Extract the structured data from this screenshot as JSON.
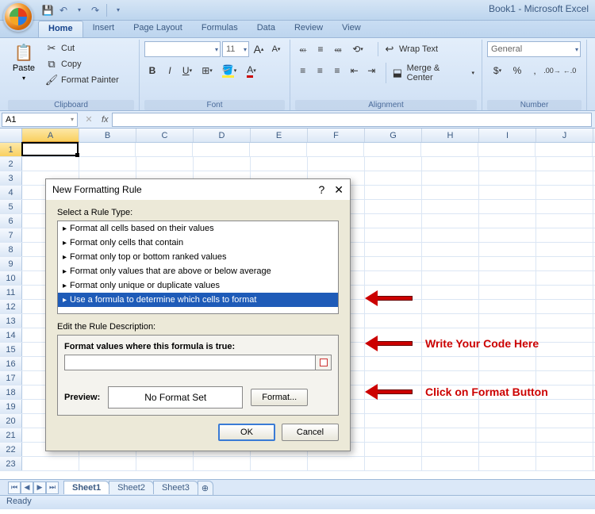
{
  "app": {
    "title": "Book1 - Microsoft Excel"
  },
  "qat": {
    "save": "💾",
    "undo": "↶",
    "redo": "↷",
    "more": "▾"
  },
  "tabs": [
    "Home",
    "Insert",
    "Page Layout",
    "Formulas",
    "Data",
    "Review",
    "View"
  ],
  "ribbon": {
    "clipboard": {
      "label": "Clipboard",
      "paste": "Paste",
      "cut": "Cut",
      "copy": "Copy",
      "painter": "Format Painter"
    },
    "font": {
      "label": "Font",
      "name_placeholder": "",
      "size": "11",
      "grow": "A",
      "shrink": "A"
    },
    "alignment": {
      "label": "Alignment",
      "wrap": "Wrap Text",
      "merge": "Merge & Center"
    },
    "number": {
      "label": "Number",
      "format": "General"
    }
  },
  "namebox": "A1",
  "columns": [
    "A",
    "B",
    "C",
    "D",
    "E",
    "F",
    "G",
    "H",
    "I",
    "J"
  ],
  "rows": [
    1,
    2,
    3,
    4,
    5,
    6,
    7,
    8,
    9,
    10,
    11,
    12,
    13,
    14,
    15,
    16,
    17,
    18,
    19,
    20,
    21,
    22,
    23
  ],
  "sheets": [
    "Sheet1",
    "Sheet2",
    "Sheet3"
  ],
  "status": "Ready",
  "dialog": {
    "title": "New Formatting Rule",
    "select_label": "Select a Rule Type:",
    "rules": [
      "Format all cells based on their values",
      "Format only cells that contain",
      "Format only top or bottom ranked values",
      "Format only values that are above or below average",
      "Format only unique or duplicate values",
      "Use a formula to determine which cells to format"
    ],
    "edit_label": "Edit the Rule Description:",
    "formula_label": "Format values where this formula is true:",
    "preview_label": "Preview:",
    "preview_text": "No Format Set",
    "format_btn": "Format...",
    "ok": "OK",
    "cancel": "Cancel",
    "help": "?",
    "close": "✕"
  },
  "annotations": {
    "a1": "Write Your Code Here",
    "a2": "Click on Format Button"
  }
}
